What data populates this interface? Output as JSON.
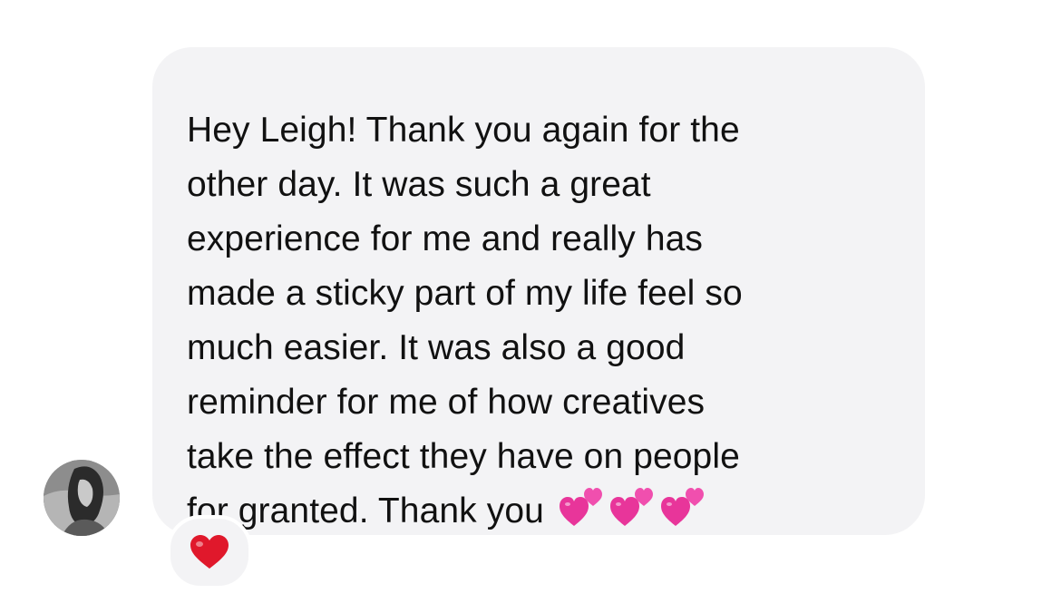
{
  "conversation": {
    "sender_avatar_icon": "user-avatar-photo",
    "message_text": "Hey Leigh! Thank you again for the\nother day. It was such a great\nexperience for me and really has\nmade a sticky part of my life feel so\nmuch easier. It was also a good\nreminder for me of how creatives\ntake the effect they have on people\nfor granted. Thank you ",
    "emojis": [
      "two-hearts-icon",
      "two-hearts-icon",
      "two-hearts-icon"
    ],
    "reaction_icon": "red-heart-icon",
    "colors": {
      "bubble": "#f3f3f5",
      "text": "#111111",
      "heart_pink": "#e8359a",
      "reaction_red": "#e0182b"
    }
  }
}
